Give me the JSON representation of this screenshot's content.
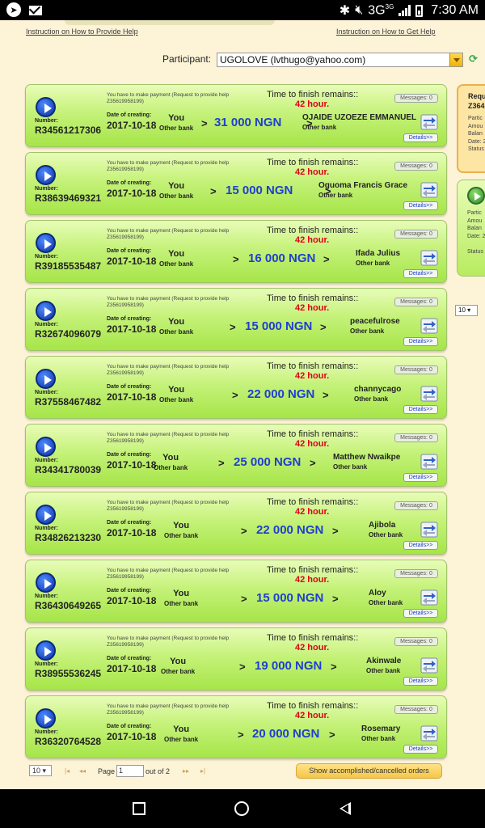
{
  "status_bar": {
    "network": "3G",
    "network_sup": "3G",
    "time": "7:30 AM"
  },
  "links": {
    "provide_help": "Instruction on How to Provide Help",
    "get_help": "Instruction on How to Get Help"
  },
  "participant": {
    "label": "Participant:",
    "value": "UGOLOVE (lvthugo@yahoo.com)"
  },
  "card_labels": {
    "number": "Number:",
    "date_of_creating": "Date of creating:",
    "time_to_finish": "Time to finish remains::",
    "details": "Details>>",
    "arrow": ">"
  },
  "orders": [
    {
      "note": "You have to make payment (Request to provide help Z35619958199)",
      "number": "R34561217306",
      "date": "2017-10-18",
      "time_remaining": "42 hour.",
      "sender": "You",
      "sender_bank": "Other bank",
      "amount": "31 000 NGN",
      "recipient": "OJAIDE UZOEZE EMMANUEL",
      "recipient_bank": "Other bank",
      "messages": "Messages: 0"
    },
    {
      "note": "You have to make payment (Request to provide help Z35619958199)",
      "number": "R38639469321",
      "date": "2017-10-18",
      "time_remaining": "42 hour.",
      "sender": "You",
      "sender_bank": "Other bank",
      "amount": "15 000 NGN",
      "recipient": "Oguoma Francis Grace",
      "recipient_bank": "Other bank",
      "messages": "Messages: 0"
    },
    {
      "note": "You have to make payment (Request to provide help Z35619958199)",
      "number": "R39185535487",
      "date": "2017-10-18",
      "time_remaining": "42 hour.",
      "sender": "You",
      "sender_bank": "Other bank",
      "amount": "16 000 NGN",
      "recipient": "Ifada Julius",
      "recipient_bank": "Other bank",
      "messages": "Messages: 0"
    },
    {
      "note": "You have to make payment (Request to provide help Z35619958199)",
      "number": "R32674096079",
      "date": "2017-10-18",
      "time_remaining": "42 hour.",
      "sender": "You",
      "sender_bank": "Other bank",
      "amount": "15 000 NGN",
      "recipient": "peacefulrose",
      "recipient_bank": "Other bank",
      "messages": "Messages: 0"
    },
    {
      "note": "You have to make payment (Request to provide help Z35619958199)",
      "number": "R37558467482",
      "date": "2017-10-18",
      "time_remaining": "42 hour.",
      "sender": "You",
      "sender_bank": "Other bank",
      "amount": "22 000 NGN",
      "recipient": "channycago",
      "recipient_bank": "Other bank",
      "messages": "Messages: 0"
    },
    {
      "note": "You have to make payment (Request to provide help Z35619958199)",
      "number": "R34341780039",
      "date": "2017-10-18",
      "time_remaining": "42 hour.",
      "sender": "You",
      "sender_bank": "Other bank",
      "amount": "25 000 NGN",
      "recipient": "Matthew Nwaikpe",
      "recipient_bank": "Other bank",
      "messages": "Messages: 0"
    },
    {
      "note": "You have to make payment (Request to provide help Z35619958199)",
      "number": "R34826213230",
      "date": "2017-10-18",
      "time_remaining": "42 hour.",
      "sender": "You",
      "sender_bank": "Other bank",
      "amount": "22 000 NGN",
      "recipient": "Ajibola",
      "recipient_bank": "Other bank",
      "messages": "Messages: 0"
    },
    {
      "note": "You have to make payment (Request to provide help Z35619958199)",
      "number": "R36430649265",
      "date": "2017-10-18",
      "time_remaining": "42 hour.",
      "sender": "You",
      "sender_bank": "Other bank",
      "amount": "15 000 NGN",
      "recipient": "Aloy",
      "recipient_bank": "Other bank",
      "messages": "Messages: 0"
    },
    {
      "note": "You have to make payment (Request to provide help Z35619958199)",
      "number": "R38955536245",
      "date": "2017-10-18",
      "time_remaining": "42 hour.",
      "sender": "You",
      "sender_bank": "Other bank",
      "amount": "19 000 NGN",
      "recipient": "Akinwale",
      "recipient_bank": "Other bank",
      "messages": "Messages: 0"
    },
    {
      "note": "You have to make payment (Request to provide help Z35619958199)",
      "number": "R36320764528",
      "date": "2017-10-18",
      "time_remaining": "42 hour.",
      "sender": "You",
      "sender_bank": "Other bank",
      "amount": "20 000 NGN",
      "recipient": "Rosemary",
      "recipient_bank": "Other bank",
      "messages": "Messages: 0"
    }
  ],
  "side_panel": {
    "card1_title": "Requ",
    "card1_id": "Z364",
    "card1_lines": [
      "Partic",
      "Amou",
      "Balan",
      "Date: 2",
      "Status"
    ],
    "card2_lines": [
      "Partic",
      "Amou",
      "Balan",
      "Date: 2"
    ],
    "card2_status": "Status",
    "page_size": "10"
  },
  "pager": {
    "page_size": "10",
    "page_label": "Page",
    "page_value": "1",
    "of_label": "out of 2",
    "accomplished_button": "Show accomplished/cancelled orders"
  },
  "colors": {
    "background": "#fdf3d7",
    "card_green": "#c5f27a",
    "amount_blue": "#1f3fd1",
    "time_red": "#e0001a",
    "accent_yellow": "#f4c64a"
  }
}
